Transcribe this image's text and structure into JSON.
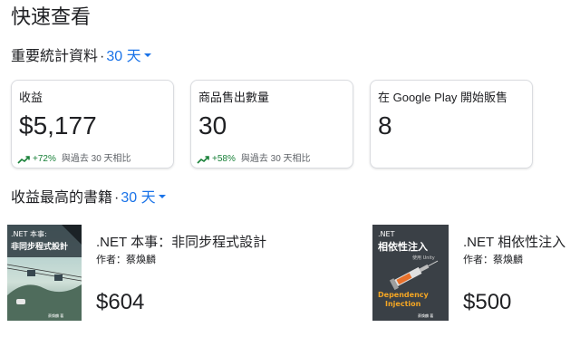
{
  "page": {
    "title": "快速查看"
  },
  "stats": {
    "heading": "重要統計資料",
    "separator": "·",
    "period": "30 天",
    "cards": [
      {
        "label": "收益",
        "value": "$5,177",
        "change": "+72%",
        "compare": "與過去 30 天相比"
      },
      {
        "label": "商品售出數量",
        "value": "30",
        "change": "+58%",
        "compare": "與過去 30 天相比"
      },
      {
        "label": "在 Google Play 開始販售",
        "value": "8"
      }
    ]
  },
  "top_books": {
    "heading": "收益最高的書籍",
    "separator": "·",
    "period": "30 天",
    "books": [
      {
        "title": ".NET 本事：非同步程式設計",
        "author": "作者：蔡煥麟",
        "price": "$604",
        "cover_text": [
          ".NET 本事:",
          "非同步程式設計",
          "蔡煥麟 著"
        ]
      },
      {
        "title": ".NET 相依性注入",
        "author": "作者：蔡煥麟",
        "price": "$500",
        "cover_text": [
          ".NET",
          "相依性注入",
          "使用 Unity",
          "Dependency",
          "Injection",
          "蔡煥麟 著"
        ]
      }
    ]
  },
  "colors": {
    "accent": "#1a73e8",
    "positive": "#188038",
    "card_border": "#dadce0"
  },
  "icons": {
    "trend": "trending-up-icon",
    "dropdown": "caret-down-icon"
  }
}
